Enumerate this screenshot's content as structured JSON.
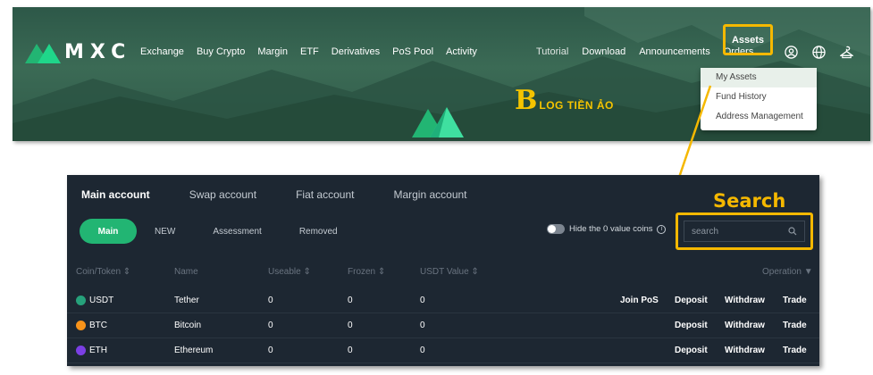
{
  "brand": {
    "name": "MXC",
    "accent": "#22b573",
    "highlight": "#f5b800"
  },
  "nav": {
    "left": [
      "Exchange",
      "Buy Crypto",
      "Margin",
      "ETF",
      "Derivatives",
      "PoS Pool",
      "Activity"
    ],
    "right": [
      "Tutorial",
      "Download",
      "Announcements",
      "Orders"
    ],
    "assets": "Assets",
    "icons": [
      "user-icon",
      "globe-icon",
      "hanger-icon"
    ]
  },
  "watermark": {
    "initial": "B",
    "text": "LOG TIỀN ẢO"
  },
  "dropdown": {
    "items": [
      "My Assets",
      "Fund History",
      "Address Management"
    ],
    "selected": "My Assets"
  },
  "account": {
    "tabs": [
      "Main account",
      "Swap account",
      "Fiat account",
      "Margin account"
    ],
    "active_tab": "Main account",
    "sub_tabs": [
      "Main",
      "NEW",
      "Assessment",
      "Removed"
    ],
    "active_sub_tab": "Main",
    "hide_zero_label": "Hide the 0 value coins",
    "hide_zero_enabled": false,
    "search_placeholder": "search",
    "columns": {
      "coin": "Coin/Token",
      "name": "Name",
      "useable": "Useable",
      "frozen": "Frozen",
      "usdt_value": "USDT Value",
      "operation": "Operation"
    },
    "rows": [
      {
        "coin": "USDT",
        "name": "Tether",
        "useable": "0",
        "frozen": "0",
        "usdt_value": "0",
        "color": "#26a17b",
        "ops": [
          "Join PoS",
          "Deposit",
          "Withdraw",
          "Trade"
        ]
      },
      {
        "coin": "BTC",
        "name": "Bitcoin",
        "useable": "0",
        "frozen": "0",
        "usdt_value": "0",
        "color": "#f7931a",
        "ops": [
          "",
          "Deposit",
          "Withdraw",
          "Trade"
        ]
      },
      {
        "coin": "ETH",
        "name": "Ethereum",
        "useable": "0",
        "frozen": "0",
        "usdt_value": "0",
        "color": "#7b3fe4",
        "ops": [
          "",
          "Deposit",
          "Withdraw",
          "Trade"
        ]
      }
    ]
  },
  "annotation": {
    "search_label": "Search"
  }
}
